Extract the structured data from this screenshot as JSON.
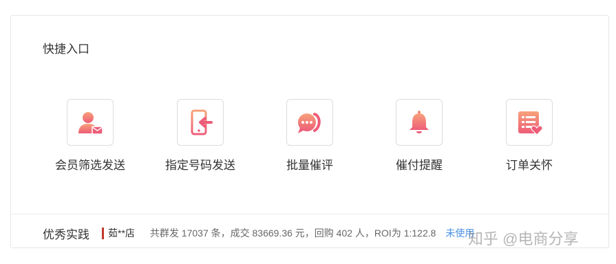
{
  "section": {
    "title": "快捷入口"
  },
  "quick_entries": [
    {
      "label": "会员筛选发送",
      "icon": "member-mail-icon"
    },
    {
      "label": "指定号码发送",
      "icon": "phone-arrow-icon"
    },
    {
      "label": "批量催评",
      "icon": "chat-bubble-icon"
    },
    {
      "label": "催付提醒",
      "icon": "bell-icon"
    },
    {
      "label": "订单关怀",
      "icon": "order-heart-icon"
    }
  ],
  "practice": {
    "title": "优秀实践",
    "store": "茹**店",
    "stats": "共群发 17037 条，成交 83669.36 元，回购 402 人，ROI为 1:122.8",
    "link": "未使用"
  },
  "watermark": "知乎 @电商分享",
  "colors": {
    "icon_gradient_top": "#f7a17a",
    "icon_gradient_bottom": "#ee5d78",
    "link": "#4a90e2",
    "store_mark": "#c0392b"
  }
}
